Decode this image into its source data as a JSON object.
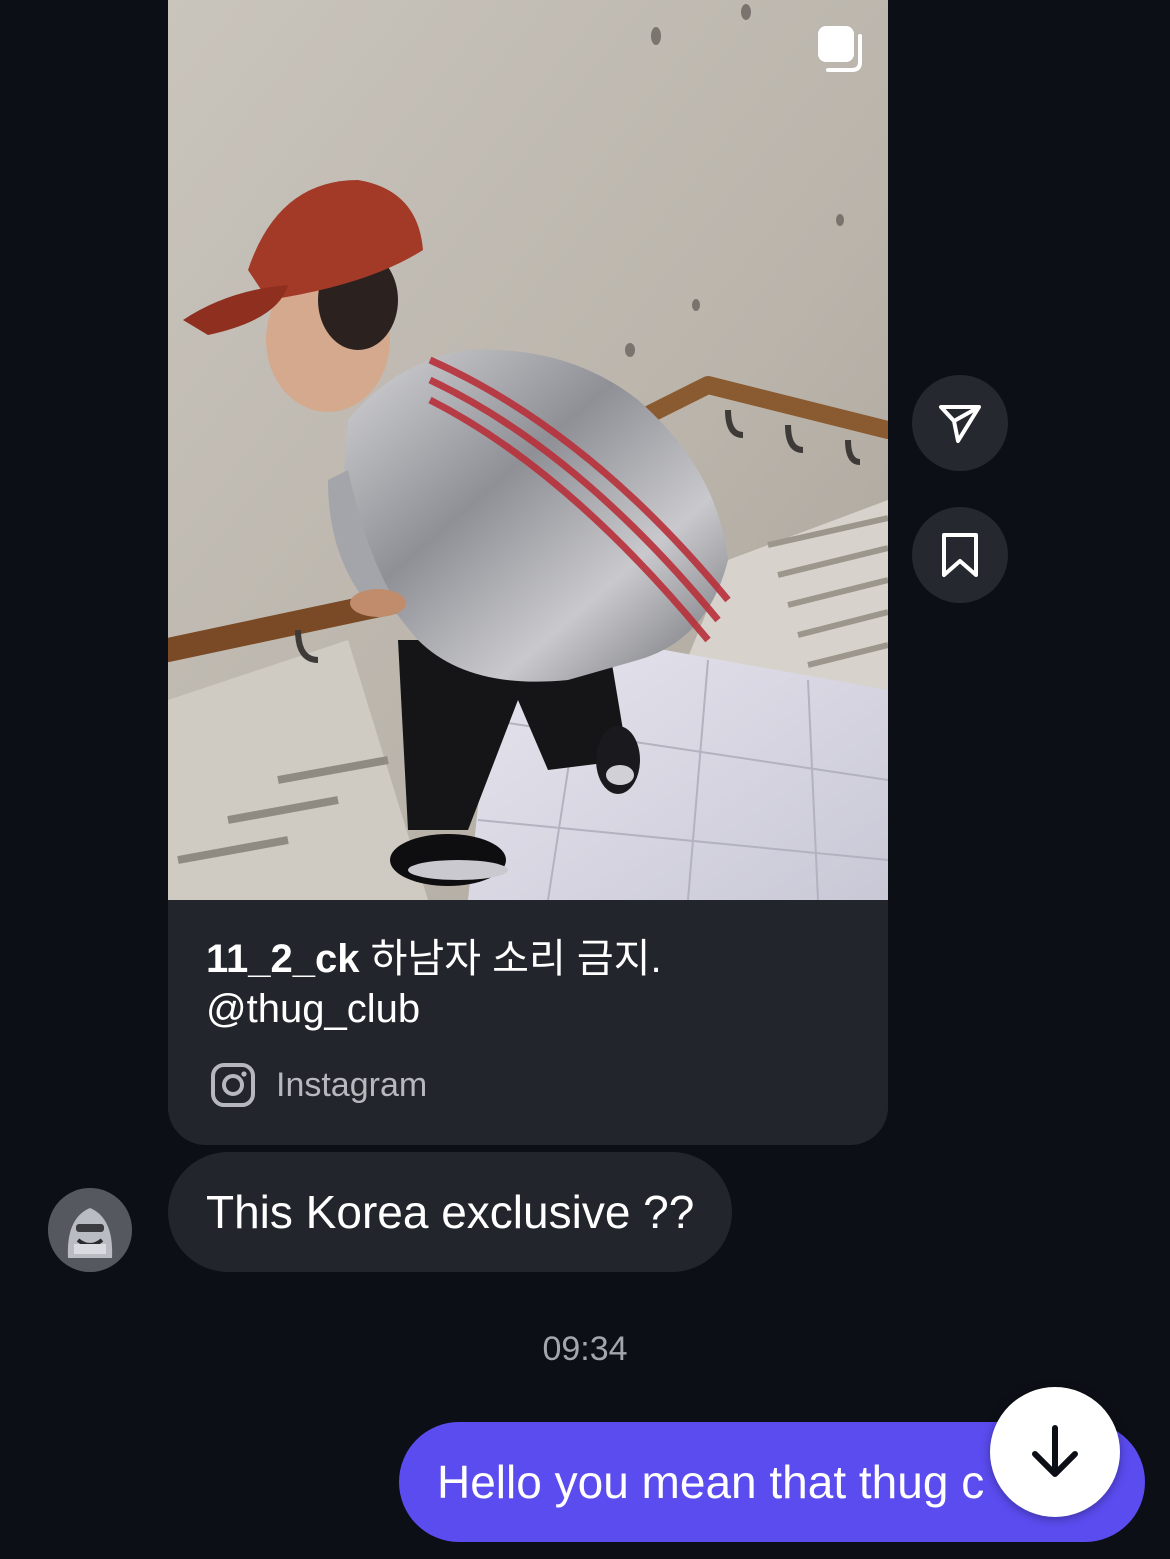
{
  "post": {
    "author": "11_2_ck",
    "caption_text": " 하남자 소리 금지.",
    "caption_mention": "@thug_club",
    "source_label": "Instagram",
    "icons": {
      "carousel": "carousel-icon",
      "source": "instagram-icon"
    }
  },
  "side_actions": {
    "share_icon": "send-icon",
    "save_icon": "bookmark-icon"
  },
  "messages": {
    "incoming": {
      "text": "This Korea exclusive ??",
      "avatar_icon": "avatar"
    },
    "timestamp": "09:34",
    "outgoing": {
      "text": "Hello you mean that thug c"
    }
  },
  "scroll_button_icon": "arrow-down-icon",
  "colors": {
    "background": "#0c0f16",
    "bubble_incoming": "#22252b",
    "bubble_outgoing": "#5b4cf0",
    "timestamp": "#a3a6ac"
  }
}
